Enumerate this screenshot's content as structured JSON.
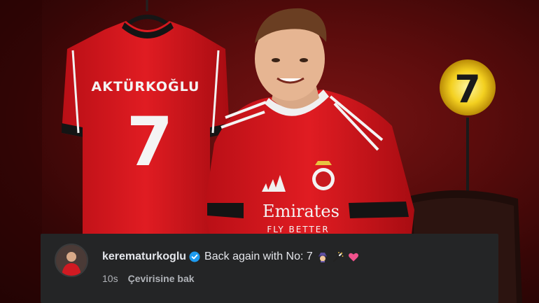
{
  "photo": {
    "jersey_name": "AKTÜRKOĞLU",
    "jersey_number": "7",
    "lamp_number": "7",
    "sponsor": "Emirates",
    "sponsor_sub": "FLY BETTER"
  },
  "comment": {
    "username": "kerematurkoglu",
    "text": "Back again with No: 7",
    "emojis": [
      "detective-emoji",
      "magic-wand-emoji",
      "heart-emoji"
    ],
    "time": "10s",
    "translate_label": "Çevirisine bak"
  },
  "colors": {
    "jersey_red": "#d8161e",
    "comment_bg": "#242526",
    "verified_blue": "#1d9bf0",
    "heart_pink": "#f0528c"
  }
}
